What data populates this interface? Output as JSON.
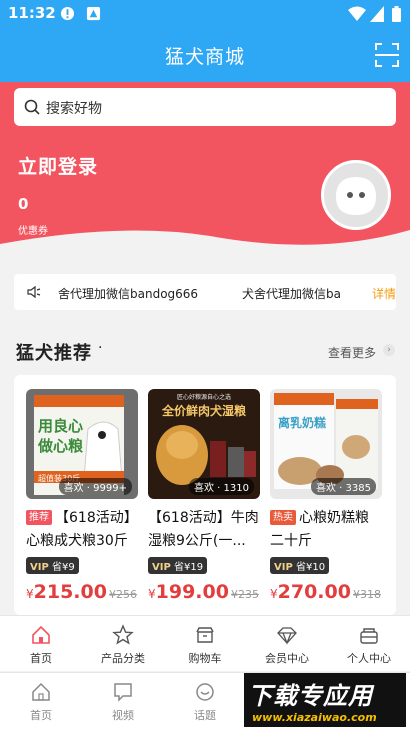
{
  "status_bar": {
    "time": "11:32"
  },
  "header": {
    "title": "猛犬商城",
    "scan_icon": "scan-icon"
  },
  "search": {
    "placeholder": "搜索好物"
  },
  "user": {
    "login_text": "立即登录",
    "coupon_count": "0",
    "coupon_label": "优惠券"
  },
  "notice": {
    "text1": "舍代理加微信bandog666",
    "text2": "犬舍代理加微信ba",
    "more": "详情"
  },
  "section": {
    "title": "猛犬推荐",
    "dot": "·",
    "more": "查看更多"
  },
  "products": [
    {
      "tag": "推荐",
      "name": "【618活动】心粮成犬粮30斤",
      "likes": "喜欢 · 9999+",
      "vip_label": "VIP",
      "vip_save": "省¥9",
      "currency": "¥",
      "price": "215.00",
      "old_price": "¥256",
      "img_text1": "用良心",
      "img_text2": "做心粮",
      "img_text3": "超值装30斤"
    },
    {
      "tag": "",
      "name": "【618活动】牛肉湿粮9公斤(一...",
      "likes": "喜欢 · 1310",
      "vip_label": "VIP",
      "vip_save": "省¥19",
      "currency": "¥",
      "price": "199.00",
      "old_price": "¥235",
      "img_text1": "匠心好粮源自心之选",
      "img_text2": "全价鲜肉犬湿粮"
    },
    {
      "tag": "热卖",
      "name": "心粮奶糕粮二十斤",
      "likes": "喜欢 · 3385",
      "vip_label": "VIP",
      "vip_save": "省¥10",
      "currency": "¥",
      "price": "270.00",
      "old_price": "¥318",
      "img_text1": "离乳奶糕"
    }
  ],
  "tabbar_store": [
    {
      "label": "首页",
      "icon": "home-icon",
      "active": true
    },
    {
      "label": "产品分类",
      "icon": "star-icon"
    },
    {
      "label": "购物车",
      "icon": "cart-icon"
    },
    {
      "label": "会员中心",
      "icon": "diamond-icon"
    },
    {
      "label": "个人中心",
      "icon": "user-center-icon"
    }
  ],
  "tabbar_app": [
    {
      "label": "首页",
      "icon": "home-outline-icon"
    },
    {
      "label": "视频",
      "icon": "video-icon"
    },
    {
      "label": "话题",
      "icon": "topic-icon"
    }
  ],
  "watermark": {
    "big": "下载专应用",
    "small": "www.xiazaiwao.com"
  },
  "colors": {
    "header_blue": "#2ea7f5",
    "hero_red": "#f2555f",
    "price_red": "#e23e3e",
    "notice_more": "#f39c12"
  }
}
